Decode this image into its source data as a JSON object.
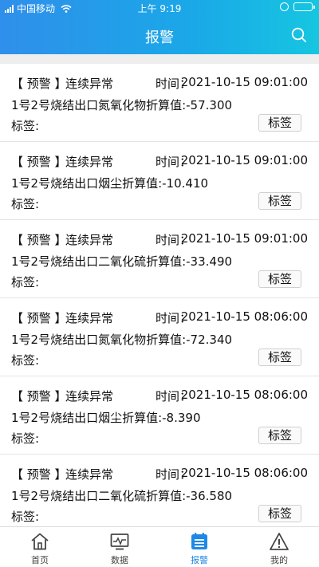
{
  "status": {
    "carrier": "中国移动",
    "time": "上午 9:19"
  },
  "header": {
    "title": "报警"
  },
  "alarms": [
    {
      "tag": "【 预警 】",
      "type": "连续异常",
      "time_label": "时间：",
      "time": "2021-10-15 09:01:00",
      "desc": "1号2号烧结出口氮氧化物折算值:-57.300",
      "label": "标签:",
      "button": "标签"
    },
    {
      "tag": "【 预警 】",
      "type": "连续异常",
      "time_label": "时间：",
      "time": "2021-10-15 09:01:00",
      "desc": "1号2号烧结出口烟尘折算值:-10.410",
      "label": "标签:",
      "button": "标签"
    },
    {
      "tag": "【 预警 】",
      "type": "连续异常",
      "time_label": "时间：",
      "time": "2021-10-15 09:01:00",
      "desc": "1号2号烧结出口二氧化硫折算值:-33.490",
      "label": "标签:",
      "button": "标签"
    },
    {
      "tag": "【 预警 】",
      "type": "连续异常",
      "time_label": "时间：",
      "time": "2021-10-15 08:06:00",
      "desc": "1号2号烧结出口氮氧化物折算值:-72.340",
      "label": "标签:",
      "button": "标签"
    },
    {
      "tag": "【 预警 】",
      "type": "连续异常",
      "time_label": "时间：",
      "time": "2021-10-15 08:06:00",
      "desc": "1号2号烧结出口烟尘折算值:-8.390",
      "label": "标签:",
      "button": "标签"
    },
    {
      "tag": "【 预警 】",
      "type": "连续异常",
      "time_label": "时间：",
      "time": "2021-10-15 08:06:00",
      "desc": "1号2号烧结出口二氧化硫折算值:-36.580",
      "label": "标签:",
      "button": "标签"
    }
  ],
  "tabbar": {
    "items": [
      {
        "label": "首页",
        "icon": "home-icon"
      },
      {
        "label": "数据",
        "icon": "chart-monitor-icon"
      },
      {
        "label": "报警",
        "icon": "alarm-list-icon",
        "active": true
      },
      {
        "label": "我的",
        "icon": "warning-triangle-icon"
      }
    ]
  },
  "colors": {
    "header_start": "#2f8fea",
    "header_end": "#16c6e0",
    "active_tab": "#1e88e5"
  }
}
